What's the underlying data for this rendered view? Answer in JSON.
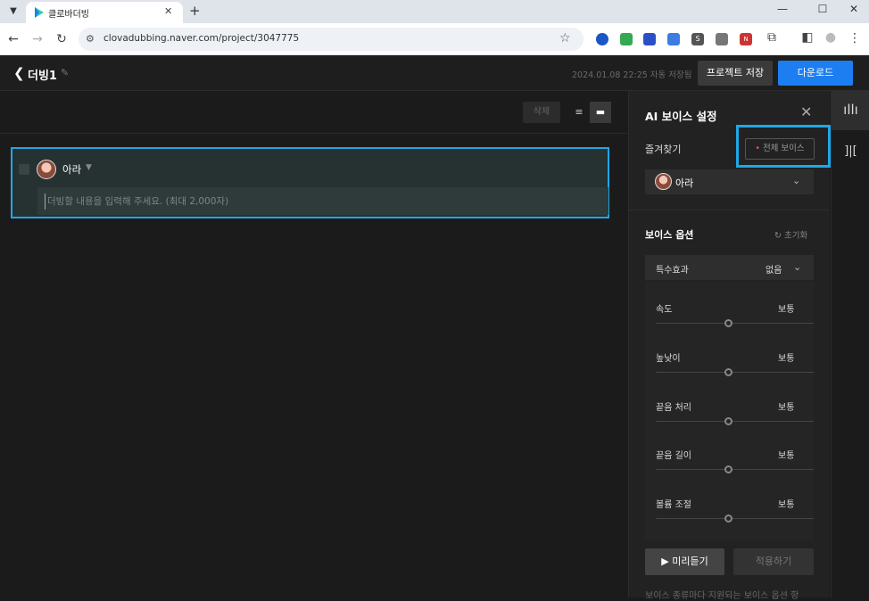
{
  "browser": {
    "tab_title": "클로바더빙",
    "tab_close": "✕",
    "new_tab": "+",
    "url": "clovadubbing.naver.com/project/3047775",
    "window_controls": {
      "minimize": "—",
      "maximize": "☐",
      "close": "✕"
    },
    "nav": {
      "back": "←",
      "forward": "→",
      "reload": "↻",
      "menu": "⋮"
    },
    "extension_labels": [
      "S",
      "N"
    ]
  },
  "header": {
    "project_title": "더빙1",
    "autosave_text": "2024.01.08 22:25 자동 저장됨",
    "save_label": "프로젝트 저장",
    "download_label": "다운로드"
  },
  "editor": {
    "delete_label": "삭제",
    "block": {
      "voice_name": "아라",
      "text_value": "",
      "placeholder": "더빙할 내용을 입력해 주세요. (최대 2,000자)"
    }
  },
  "panel": {
    "title": "AI 보이스 설정",
    "favorites_label": "즐겨찾기",
    "all_voices_label": "전체 보이스",
    "selected_voice": "아라",
    "options_title": "보이스 옵션",
    "reset_label": "초기화",
    "effect_label": "특수효과",
    "effect_value": "없음",
    "options": [
      {
        "label": "속도",
        "value": "보통",
        "level": 0.5
      },
      {
        "label": "높낮이",
        "value": "보통",
        "level": 0.5
      },
      {
        "label": "끝음 처리",
        "value": "보통",
        "level": 0.5
      },
      {
        "label": "끝음 길이",
        "value": "보통",
        "level": 0.5
      },
      {
        "label": "볼륨 조절",
        "value": "보통",
        "level": 0.5
      }
    ],
    "preview_label": "▶ 미리듣기",
    "apply_label": "적용하기",
    "footnote": "보이스 종류마다 지원되는 보이스 옵션 항"
  },
  "colors": {
    "accent": "#1c7ef1",
    "highlight": "#1fa7e8",
    "dot": "#e8475b"
  }
}
